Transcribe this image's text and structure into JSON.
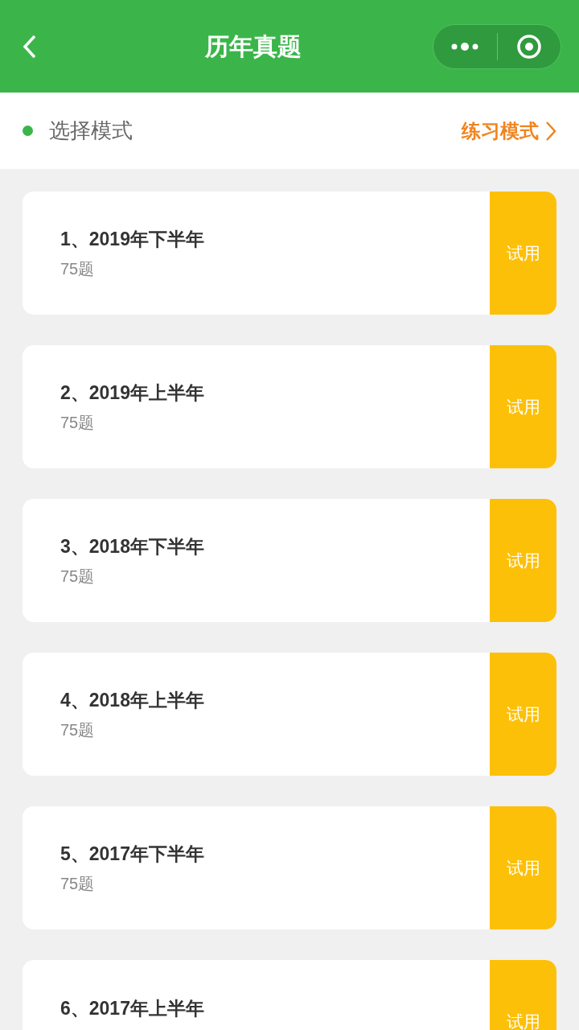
{
  "nav": {
    "title": "历年真题"
  },
  "mode_bar": {
    "label": "选择模式",
    "action": "练习模式"
  },
  "papers": [
    {
      "title": "1、2019年下半年",
      "count": "75题",
      "badge": "试用"
    },
    {
      "title": "2、2019年上半年",
      "count": "75题",
      "badge": "试用"
    },
    {
      "title": "3、2018年下半年",
      "count": "75题",
      "badge": "试用"
    },
    {
      "title": "4、2018年上半年",
      "count": "75题",
      "badge": "试用"
    },
    {
      "title": "5、2017年下半年",
      "count": "75题",
      "badge": "试用"
    },
    {
      "title": "6、2017年上半年",
      "badge": "试用"
    }
  ]
}
